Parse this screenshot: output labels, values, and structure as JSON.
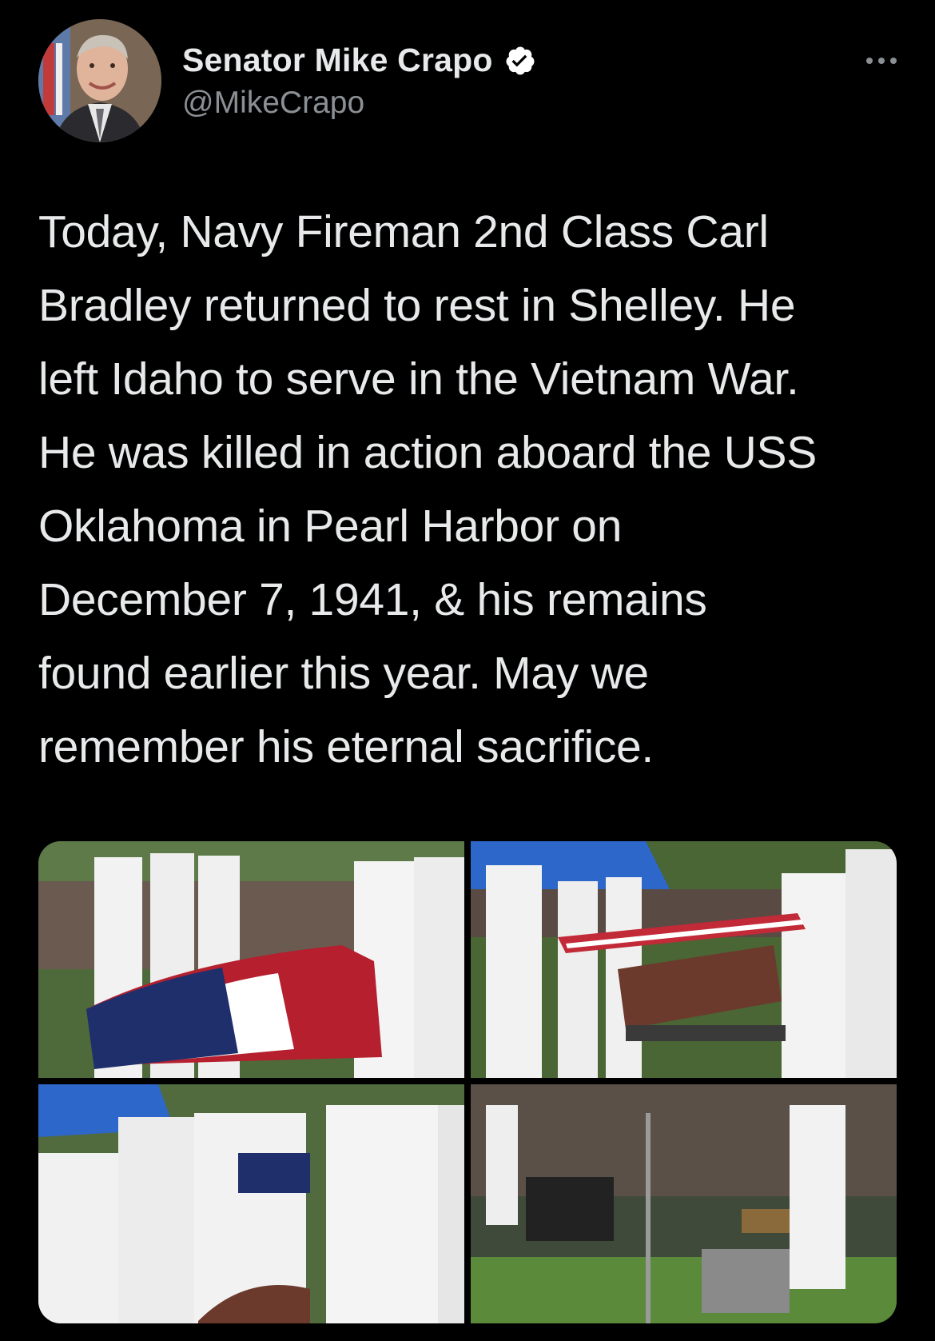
{
  "author": {
    "display_name": "Senator Mike Crapo",
    "handle": "@MikeCrapo",
    "verified": true
  },
  "icons": {
    "verified": "verified-badge-icon",
    "more": "more-options-icon"
  },
  "tweet": {
    "text": "Today, Navy Fireman 2nd Class Carl\nBradley returned to rest in Shelley. He\nleft Idaho to serve in the Vietnam War.\nHe was killed in action aboard the USS\nOklahoma in Pearl Harbor on\nDecember 7, 1941, & his remains\nfound earlier this year. May we\nremember his eternal sacrifice."
  },
  "media": {
    "count": 4
  },
  "colors": {
    "background": "#000000",
    "text": "#e7e9ea",
    "secondary_text": "#8b9095",
    "verified_badge": "#ffffff"
  }
}
